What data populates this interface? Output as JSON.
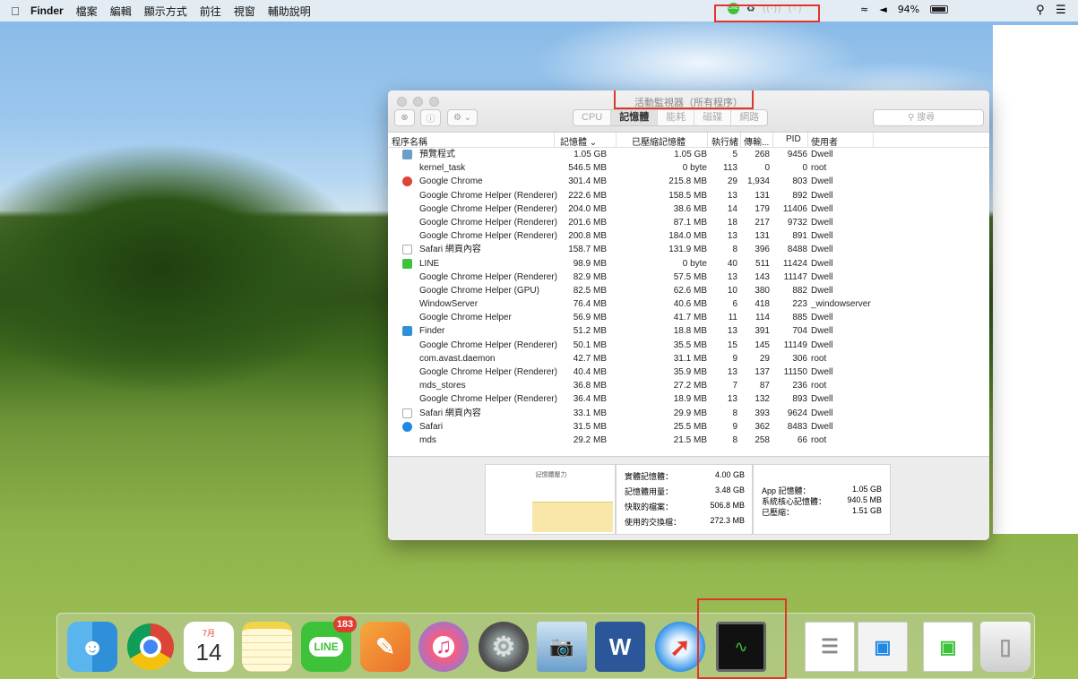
{
  "menubar": {
    "apple": "",
    "app_name": "Finder",
    "items": [
      "檔案",
      "編輯",
      "顯示方式",
      "前往",
      "視窗",
      "輔助說明"
    ],
    "status": {
      "line_icon": "LINE",
      "battery": "94%"
    }
  },
  "window": {
    "title": "活動監視器（所有程序）",
    "tabs": [
      "CPU",
      "記憶體",
      "能耗",
      "磁碟",
      "網路"
    ],
    "active_tab": "記憶體",
    "search_placeholder": "搜尋",
    "columns": [
      "程序名稱",
      "記憶體 ⌄",
      "已壓縮記憶體",
      "執行緒",
      "傳輸...",
      "PID",
      "使用者"
    ],
    "rows": [
      {
        "name": "預覽程式",
        "mem": "1.05 GB",
        "comp": "1.05 GB",
        "thr": "5",
        "port": "268",
        "pid": "9456",
        "user": "Dwell",
        "icon": "preview-icon"
      },
      {
        "name": "kernel_task",
        "mem": "546.5 MB",
        "comp": "0 byte",
        "thr": "113",
        "port": "0",
        "pid": "0",
        "user": "root",
        "icon": ""
      },
      {
        "name": "Google Chrome",
        "mem": "301.4 MB",
        "comp": "215.8 MB",
        "thr": "29",
        "port": "1,934",
        "pid": "803",
        "user": "Dwell",
        "icon": "chrome-icon"
      },
      {
        "name": "Google Chrome Helper (Renderer)",
        "mem": "222.6 MB",
        "comp": "158.5 MB",
        "thr": "13",
        "port": "131",
        "pid": "892",
        "user": "Dwell",
        "icon": ""
      },
      {
        "name": "Google Chrome Helper (Renderer)",
        "mem": "204.0 MB",
        "comp": "38.6 MB",
        "thr": "14",
        "port": "179",
        "pid": "11406",
        "user": "Dwell",
        "icon": ""
      },
      {
        "name": "Google Chrome Helper (Renderer)",
        "mem": "201.6 MB",
        "comp": "87.1 MB",
        "thr": "18",
        "port": "217",
        "pid": "9732",
        "user": "Dwell",
        "icon": ""
      },
      {
        "name": "Google Chrome Helper (Renderer)",
        "mem": "200.8 MB",
        "comp": "184.0 MB",
        "thr": "13",
        "port": "131",
        "pid": "891",
        "user": "Dwell",
        "icon": ""
      },
      {
        "name": "Safari 網頁內容",
        "mem": "158.7 MB",
        "comp": "131.9 MB",
        "thr": "8",
        "port": "396",
        "pid": "8488",
        "user": "Dwell",
        "icon": "shield-icon"
      },
      {
        "name": "LINE",
        "mem": "98.9 MB",
        "comp": "0 byte",
        "thr": "40",
        "port": "511",
        "pid": "11424",
        "user": "Dwell",
        "icon": "line-icon"
      },
      {
        "name": "Google Chrome Helper (Renderer)",
        "mem": "82.9 MB",
        "comp": "57.5 MB",
        "thr": "13",
        "port": "143",
        "pid": "11147",
        "user": "Dwell",
        "icon": ""
      },
      {
        "name": "Google Chrome Helper (GPU)",
        "mem": "82.5 MB",
        "comp": "62.6 MB",
        "thr": "10",
        "port": "380",
        "pid": "882",
        "user": "Dwell",
        "icon": ""
      },
      {
        "name": "WindowServer",
        "mem": "76.4 MB",
        "comp": "40.6 MB",
        "thr": "6",
        "port": "418",
        "pid": "223",
        "user": "_windowserver",
        "icon": ""
      },
      {
        "name": "Google Chrome Helper",
        "mem": "56.9 MB",
        "comp": "41.7 MB",
        "thr": "11",
        "port": "114",
        "pid": "885",
        "user": "Dwell",
        "icon": ""
      },
      {
        "name": "Finder",
        "mem": "51.2 MB",
        "comp": "18.8 MB",
        "thr": "13",
        "port": "391",
        "pid": "704",
        "user": "Dwell",
        "icon": "finder-icon"
      },
      {
        "name": "Google Chrome Helper (Renderer)",
        "mem": "50.1 MB",
        "comp": "35.5 MB",
        "thr": "15",
        "port": "145",
        "pid": "11149",
        "user": "Dwell",
        "icon": ""
      },
      {
        "name": "com.avast.daemon",
        "mem": "42.7 MB",
        "comp": "31.1 MB",
        "thr": "9",
        "port": "29",
        "pid": "306",
        "user": "root",
        "icon": ""
      },
      {
        "name": "Google Chrome Helper (Renderer)",
        "mem": "40.4 MB",
        "comp": "35.9 MB",
        "thr": "13",
        "port": "137",
        "pid": "11150",
        "user": "Dwell",
        "icon": ""
      },
      {
        "name": "mds_stores",
        "mem": "36.8 MB",
        "comp": "27.2 MB",
        "thr": "7",
        "port": "87",
        "pid": "236",
        "user": "root",
        "icon": ""
      },
      {
        "name": "Google Chrome Helper (Renderer)",
        "mem": "36.4 MB",
        "comp": "18.9 MB",
        "thr": "13",
        "port": "132",
        "pid": "893",
        "user": "Dwell",
        "icon": ""
      },
      {
        "name": "Safari 網頁內容",
        "mem": "33.1 MB",
        "comp": "29.9 MB",
        "thr": "8",
        "port": "393",
        "pid": "9624",
        "user": "Dwell",
        "icon": "shield-icon"
      },
      {
        "name": "Safari",
        "mem": "31.5 MB",
        "comp": "25.5 MB",
        "thr": "9",
        "port": "362",
        "pid": "8483",
        "user": "Dwell",
        "icon": "safari-icon"
      },
      {
        "name": "mds",
        "mem": "29.2 MB",
        "comp": "21.5 MB",
        "thr": "8",
        "port": "258",
        "pid": "66",
        "user": "root",
        "icon": ""
      }
    ],
    "footer": {
      "pressure_label": "記憶體壓力",
      "pressure_fill": 0.43,
      "stats": [
        {
          "label": "實體記憶體：",
          "value": "4.00 GB"
        },
        {
          "label": "記憶體用量：",
          "value": "3.48 GB"
        },
        {
          "label": "快取的檔案：",
          "value": "506.8 MB"
        },
        {
          "label": "使用的交換檔：",
          "value": "272.3 MB"
        }
      ],
      "stats2": [
        {
          "label": "App 記憶體：",
          "value": "1.05 GB"
        },
        {
          "label": "系統核心記憶體：",
          "value": "940.5 MB"
        },
        {
          "label": "已壓縮：",
          "value": "1.51 GB"
        }
      ]
    }
  },
  "dock": {
    "calendar_month": "7月",
    "calendar_day": "14",
    "line_badge": "183",
    "line_label": "LINE",
    "word_letter": "W",
    "items": [
      "finder-icon",
      "chrome-icon",
      "calendar-icon",
      "notes-icon",
      "line-icon",
      "pages-icon",
      "itunes-icon",
      "system-preferences-icon",
      "preview-icon",
      "word-icon",
      "safari-icon",
      "activity-monitor-icon",
      "document-icon",
      "screenshot-icon",
      "screenshot2-icon",
      "trash-icon"
    ]
  }
}
